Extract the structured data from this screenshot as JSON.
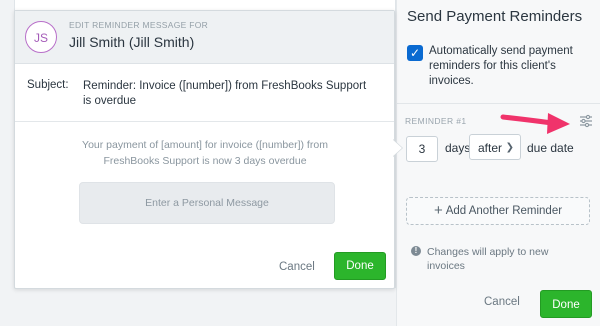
{
  "modal": {
    "avatar_initials": "JS",
    "edit_for_label": "EDIT REMINDER MESSAGE FOR",
    "client_name": "Jill Smith (Jill Smith)",
    "subject_label": "Subject:",
    "subject_value": "Reminder: Invoice ([number]) from FreshBooks Support is overdue",
    "body_text": "Your payment of [amount] for invoice ([number]) from FreshBooks Support is now 3 days overdue",
    "message_placeholder": "Enter a Personal Message",
    "cancel_label": "Cancel",
    "done_label": "Done"
  },
  "panel": {
    "title": "Send Payment Reminders",
    "auto_send_checked": true,
    "auto_send_label": "Automatically send payment reminders for this client's invoices.",
    "reminder_label": "REMINDER #1",
    "days_value": "3",
    "days_label": "days",
    "when_value": "after",
    "due_label": "due date",
    "add_reminder_label": "Add Another Reminder",
    "info_text": "Changes will apply to new invoices",
    "cancel_label": "Cancel",
    "done_label": "Done"
  },
  "colors": {
    "accent_blue": "#0a6ad1",
    "done_green": "#2cb52c",
    "avatar_purple": "#a45bb8",
    "annotation_pink": "#f0336b"
  },
  "icons": {
    "checkbox": "check-icon",
    "settings": "sliders-icon",
    "add": "plus-icon",
    "info": "info-icon",
    "select": "chevron-down-icon"
  }
}
